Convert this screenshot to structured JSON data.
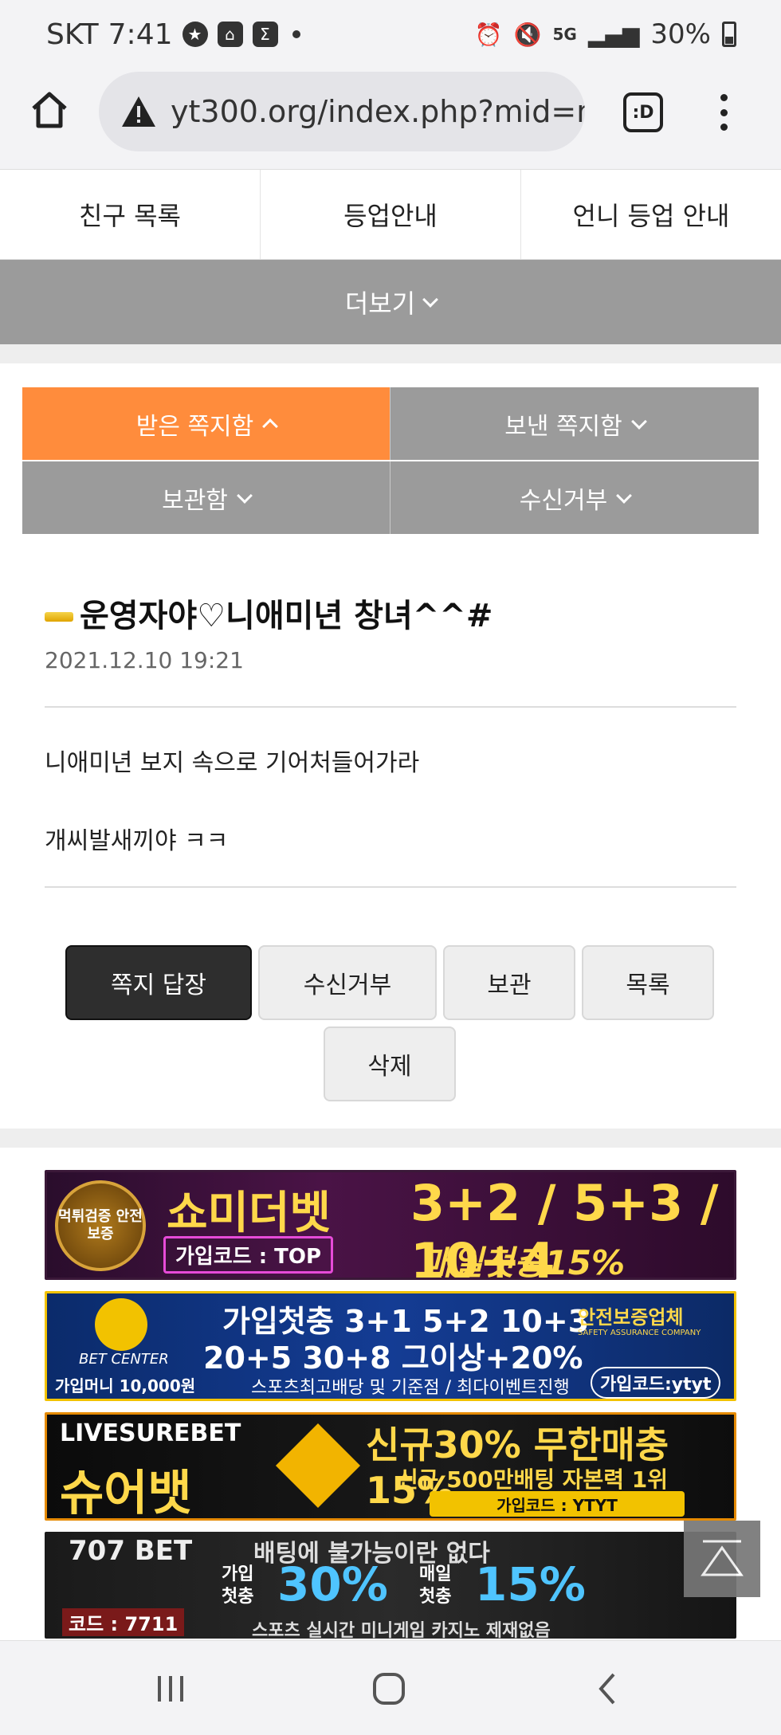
{
  "status_bar": {
    "carrier": "SKT",
    "time": "7:41",
    "battery": "30%",
    "network": "5G",
    "icons": [
      "star-circle-icon",
      "home-badge-icon",
      "sigma-icon",
      "alarm-icon",
      "mute-icon",
      "signal-icon",
      "battery-icon"
    ]
  },
  "browser": {
    "url": "yt300.org/index.php?mid=m",
    "tab_label": ":D"
  },
  "top_nav": {
    "items": [
      {
        "label": "친구 목록"
      },
      {
        "label": "등업안내"
      },
      {
        "label": "언니 등업 안내"
      }
    ],
    "more_label": "더보기"
  },
  "message_tabs": [
    {
      "label": "받은 쪽지함",
      "active": true
    },
    {
      "label": "보낸 쪽지함",
      "active": false
    },
    {
      "label": "보관함",
      "active": false
    },
    {
      "label": "수신거부",
      "active": false
    }
  ],
  "message": {
    "title": "운영자야♡니애미년 창녀^^#",
    "date": "2021.12.10 19:21",
    "body": [
      "니애미년 보지 속으로 기어처들어가라",
      "개씨발새끼야 ㅋㅋ"
    ]
  },
  "actions": {
    "reply": "쪽지 답장",
    "block": "수신거부",
    "keep": "보관",
    "list": "목록",
    "delete": "삭제"
  },
  "banners": [
    {
      "seal": "먹튀검증 안전보증",
      "headline": "쇼미더벳",
      "promo": "3+2 / 5+3 / 10+4",
      "code": "가입코드 : TOP",
      "sub": "매일첫충15%"
    },
    {
      "brand": "BET CENTER",
      "money": "가입머니 10,000원",
      "headline": "가입첫충 3+1 5+2 10+3",
      "headline2": "20+5 30+8 그이상+20%",
      "sub": "스포츠최고배당 및 기준점 / 최다이벤트진행",
      "badge": "안전보증업체",
      "badge_sub": "SAFETY ASSURANCE COMPANY",
      "code": "가입코드:ytyt"
    },
    {
      "brand": "LIVESUREBET",
      "brand_kr": "슈어뱃",
      "headline": "신규30% 무한매충15%",
      "sub": "신규 500만배팅 자본력 1위",
      "code": "가입코드 : YTYT"
    },
    {
      "brand": "707 BET",
      "code": "코드 : 7711",
      "headline": "배팅에 불가능이란 없다",
      "join": "가입 첫충",
      "pct1": "30%",
      "daily": "매일 첫충",
      "pct2": "15%",
      "sub": "스포츠 실시간 미니게임 카지노 제재없음"
    }
  ]
}
